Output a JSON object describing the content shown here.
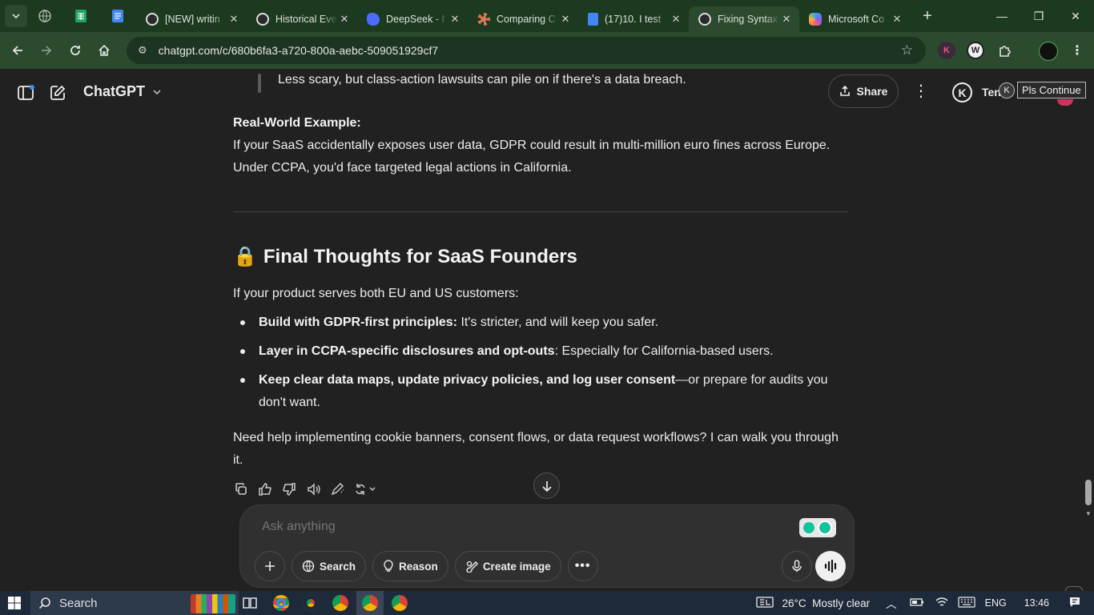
{
  "browser": {
    "tabs": [
      {
        "label": "[NEW] writin",
        "icon": "chatgpt-icon",
        "active": false
      },
      {
        "label": "Historical Eve",
        "icon": "chatgpt-icon",
        "active": false
      },
      {
        "label": "DeepSeek - I",
        "icon": "deepseek-icon",
        "active": false
      },
      {
        "label": "Comparing C",
        "icon": "claude-icon",
        "active": false
      },
      {
        "label": "(17)10. I test",
        "icon": "docs-icon",
        "active": false
      },
      {
        "label": "Fixing Syntax",
        "icon": "chatgpt-icon",
        "active": true
      },
      {
        "label": "Microsoft Co",
        "icon": "copilot-icon",
        "active": false
      }
    ],
    "url": "chatgpt.com/c/680b6fa3-a720-800a-aebc-509051929cf7"
  },
  "header": {
    "model": "ChatGPT",
    "share_label": "Share",
    "user_badge": "K",
    "user_name": "Ten",
    "tooltip_badge": "K",
    "tooltip": "Pls Continue"
  },
  "message": {
    "quote": "Less scary, but class-action lawsuits can pile on if there's a data breach.",
    "example_heading": "Real-World Example:",
    "example_line1": "If your SaaS accidentally exposes user data, GDPR could result in multi-million euro fines across Europe.",
    "example_line2": "Under CCPA, you'd face targeted legal actions in California.",
    "section_emoji": "🔒",
    "section_title": "Final Thoughts for SaaS Founders",
    "intro": "If your product serves both EU and US customers:",
    "bullets": [
      {
        "bold": "Build with GDPR-first principles:",
        "text": " It's stricter, and will keep you safer."
      },
      {
        "bold": "Layer in CCPA-specific disclosures and opt-outs",
        "text": ": Especially for California-based users."
      },
      {
        "bold": "Keep clear data maps, update privacy policies, and log user consent",
        "text": "—or prepare for audits you don't want."
      }
    ],
    "closing": "Need help implementing cookie banners, consent flows, or data request workflows? I can walk you through it."
  },
  "composer": {
    "placeholder": "Ask anything",
    "search_label": "Search",
    "reason_label": "Reason",
    "create_image_label": "Create image"
  },
  "taskbar": {
    "search_label": "Search",
    "weather": "26°C  Mostly clear",
    "language": "ENG",
    "time": "13:46"
  },
  "colors": {
    "browser_frame": "#1b3a1f",
    "toolbar": "#2b4a2e",
    "page_bg": "#212121",
    "composer_bg": "#303030"
  }
}
